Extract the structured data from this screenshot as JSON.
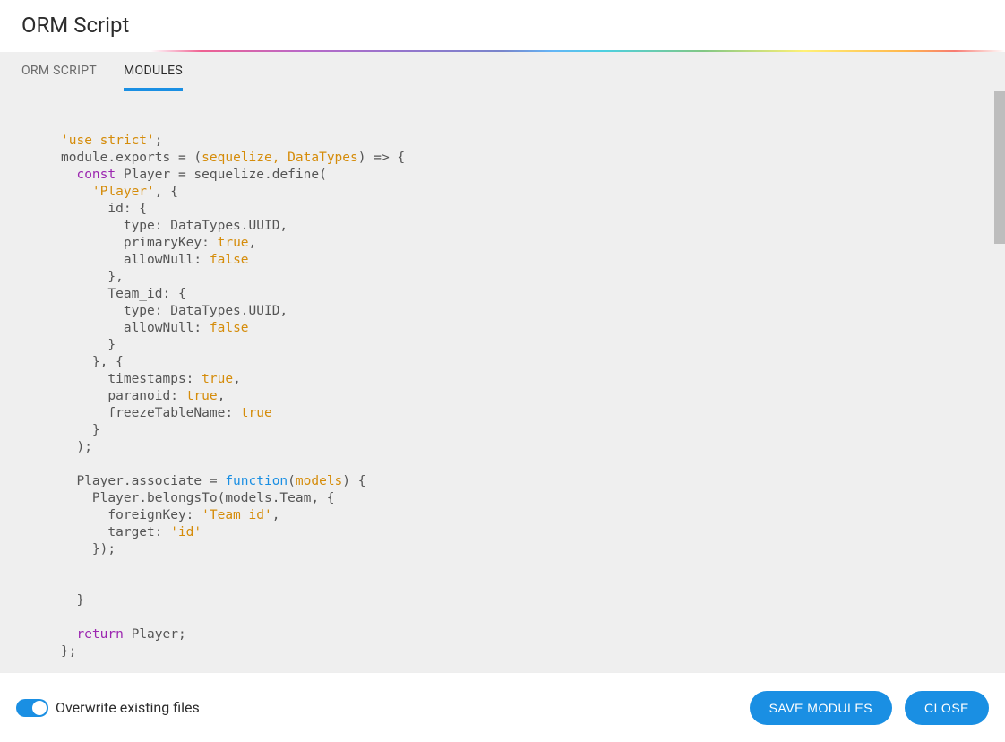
{
  "header": {
    "title": "ORM Script"
  },
  "tabs": {
    "orm_script": "ORM SCRIPT",
    "modules": "MODULES",
    "active": "modules"
  },
  "code": {
    "l1": "'use strict'",
    "l2a": "module",
    "l2b": ".exports = (",
    "l2c": "sequelize, DataTypes",
    "l2d": ") => {",
    "l3a": "  ",
    "l3kw": "const",
    "l3b": " Player = sequelize.define(",
    "l4a": "    ",
    "l4s": "'Player'",
    "l4b": ", {",
    "l5": "      id: {",
    "l6": "        type: DataTypes.UUID,",
    "l7a": "        primaryKey: ",
    "l7b": "true",
    "l7c": ",",
    "l8a": "        allowNull: ",
    "l8b": "false",
    "l9": "      },",
    "l10": "      Team_id: {",
    "l11": "        type: DataTypes.UUID,",
    "l12a": "        allowNull: ",
    "l12b": "false",
    "l13": "      }",
    "l14": "    }, {",
    "l15a": "      timestamps: ",
    "l15b": "true",
    "l15c": ",",
    "l16a": "      paranoid: ",
    "l16b": "true",
    "l16c": ",",
    "l17a": "      freezeTableName: ",
    "l17b": "true",
    "l18": "    }",
    "l19": "  );",
    "blank": "",
    "l21a": "  Player.associate = ",
    "l21kw": "function",
    "l21b": "(",
    "l21arg": "models",
    "l21c": ") {",
    "l22": "    Player.belongsTo(models.Team, {",
    "l23a": "      foreignKey: ",
    "l23s": "'Team_id'",
    "l23b": ",",
    "l24a": "      target: ",
    "l24s": "'id'",
    "l25": "    });",
    "l27": "  }",
    "l29a": "  ",
    "l29kw": "return",
    "l29b": " Player;",
    "l30": "};"
  },
  "footer": {
    "overwrite_label": "Overwrite existing files",
    "overwrite_on": true,
    "save": "SAVE MODULES",
    "close": "CLOSE"
  }
}
